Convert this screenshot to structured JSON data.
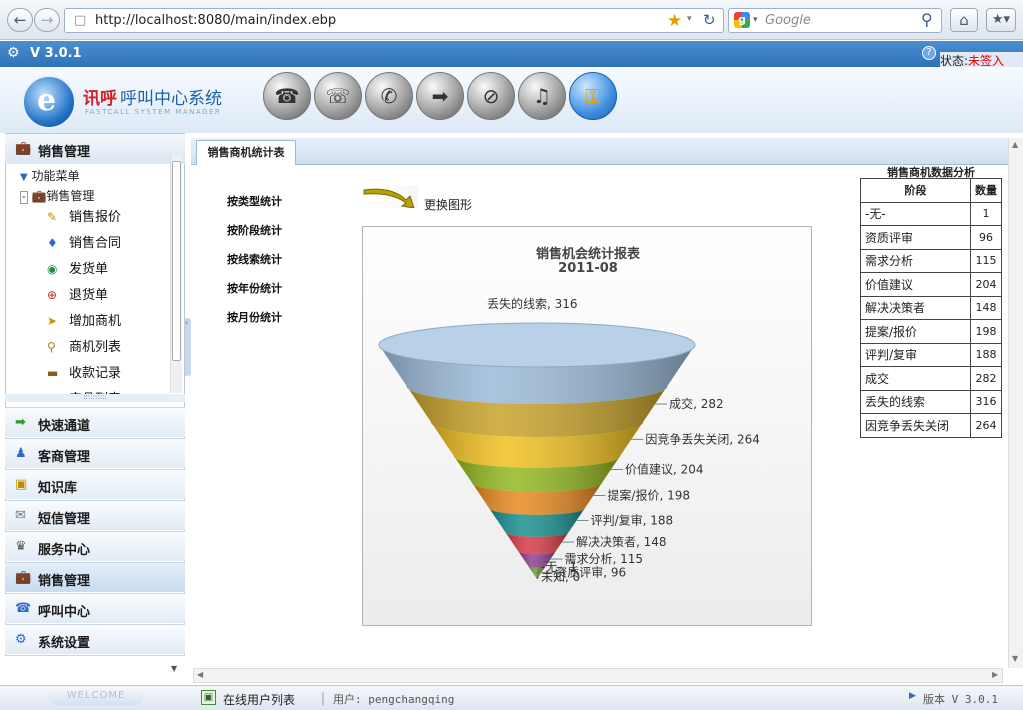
{
  "browser": {
    "url": "http://localhost:8080/main/index.ebp",
    "search_placeholder": "Google"
  },
  "app": {
    "version": "V 3.0.1",
    "status_label": "状态:",
    "status_value": "未签入",
    "logo_name": "讯呼",
    "logo_title": "呼叫中心系统",
    "logo_sub": "FASTCALL SYSTEM MANAGER"
  },
  "sidebar": {
    "section_title": "销售管理",
    "tree_root": "功能菜单",
    "tree_node": "销售管理",
    "items": [
      {
        "label": "销售报价",
        "icon": "quote-icon"
      },
      {
        "label": "销售合同",
        "icon": "contract-icon"
      },
      {
        "label": "发货单",
        "icon": "shipment-icon"
      },
      {
        "label": "退货单",
        "icon": "return-icon"
      },
      {
        "label": "增加商机",
        "icon": "add-opportunity-icon"
      },
      {
        "label": "商机列表",
        "icon": "opportunity-list-icon"
      },
      {
        "label": "收款记录",
        "icon": "payment-icon"
      },
      {
        "label": "产品列表",
        "icon": "product-icon"
      }
    ],
    "accordion": [
      {
        "label": "快速通道",
        "icon": "arrow-icon"
      },
      {
        "label": "客商管理",
        "icon": "customer-icon"
      },
      {
        "label": "知识库",
        "icon": "knowledge-icon"
      },
      {
        "label": "短信管理",
        "icon": "sms-icon"
      },
      {
        "label": "服务中心",
        "icon": "service-icon"
      },
      {
        "label": "销售管理",
        "icon": "briefcase-icon"
      },
      {
        "label": "呼叫中心",
        "icon": "phone-icon"
      },
      {
        "label": "系统设置",
        "icon": "settings-icon"
      }
    ],
    "welcome": "WELCOME"
  },
  "content": {
    "tab": "销售商机统计表",
    "stat_links": [
      "按类型统计",
      "按阶段统计",
      "按线索统计",
      "按年份统计",
      "按月份统计"
    ],
    "change_chart": "更换图形"
  },
  "chart_data": {
    "type": "funnel",
    "title": "销售机会统计报表",
    "subtitle": "2011-08",
    "categories": [
      "丢失的线索",
      "成交",
      "因竞争丢失关闭",
      "价值建议",
      "提案/报价",
      "评判/复审",
      "解决决策者",
      "需求分析",
      "资质评审",
      "-无-",
      "未知"
    ],
    "values": [
      316,
      282,
      264,
      204,
      198,
      188,
      148,
      115,
      96,
      1,
      0
    ],
    "colors": [
      "#9bbad8",
      "#c8a22a",
      "#f0c020",
      "#93b820",
      "#e88a20",
      "#1a8f90",
      "#d83a44",
      "#8f3f8f",
      "#6a9a30",
      "#c8c02a",
      "#b8b020"
    ]
  },
  "summary": {
    "title": "销售商机数据分析",
    "headers": [
      "阶段",
      "数量"
    ],
    "rows": [
      [
        "-无-",
        "1"
      ],
      [
        "资质评审",
        "96"
      ],
      [
        "需求分析",
        "115"
      ],
      [
        "价值建议",
        "204"
      ],
      [
        "解决决策者",
        "148"
      ],
      [
        "提案/报价",
        "198"
      ],
      [
        "评判/复审",
        "188"
      ],
      [
        "成交",
        "282"
      ],
      [
        "丢失的线索",
        "316"
      ],
      [
        "因竞争丢失关闭",
        "264"
      ]
    ]
  },
  "footer": {
    "online": "在线用户列表",
    "user": "用户: pengchangqing",
    "version": "版本 V 3.0.1"
  }
}
